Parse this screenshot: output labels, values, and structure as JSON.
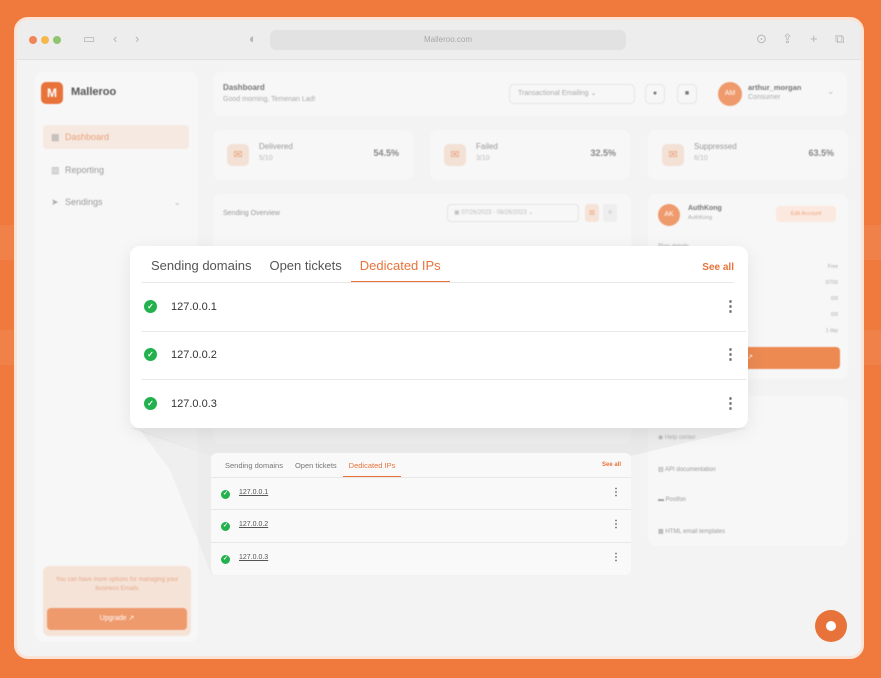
{
  "browser": {
    "url": "Malleroo.com"
  },
  "colors": {
    "accent": "#e8733a",
    "success": "#22b14c"
  },
  "sidebar": {
    "brand": "Malleroo",
    "items": [
      {
        "label": "Dashboard",
        "icon": "dashboard-icon"
      },
      {
        "label": "Reporting",
        "icon": "chart-icon"
      },
      {
        "label": "Sendings",
        "icon": "send-icon"
      }
    ],
    "upgrade_text": "You can have more options for managing your business Emails",
    "upgrade_label": "Upgrade"
  },
  "header": {
    "title": "Dashboard",
    "greeting": "Good morning, Temenan Lad!",
    "dropdown": "Transactional Emailing",
    "user_initials": "AM",
    "user_name": "arthur_morgan",
    "user_role": "Consumer"
  },
  "stats": [
    {
      "label": "Delivered",
      "value": "5/10",
      "percent": "54.5%"
    },
    {
      "label": "Failed",
      "value": "3/10",
      "percent": "32.5%"
    },
    {
      "label": "Suppressed",
      "value": "6/10",
      "percent": "63.5%"
    }
  ],
  "overview": {
    "title": "Sending Overview",
    "date_range": "07/26/2023 - 08/26/2023"
  },
  "account": {
    "initials": "AK",
    "name": "AuthKong",
    "sub": "AuthKong",
    "edit_label": "Edit Account",
    "plan_label": "Plan details",
    "plan_rows": [
      "Free",
      "0/700",
      "0/0",
      "0/0",
      "1 day"
    ]
  },
  "help": {
    "items": [
      "Help center",
      "API documentation",
      "Postfon",
      "HTML email templates"
    ]
  },
  "ips_panel": {
    "tabs": [
      "Sending domains",
      "Open tickets",
      "Dedicated IPs"
    ],
    "active_tab": 2,
    "see_all": "See all",
    "ips": [
      "127.0.0.1",
      "127.0.0.2",
      "127.0.0.3"
    ]
  }
}
